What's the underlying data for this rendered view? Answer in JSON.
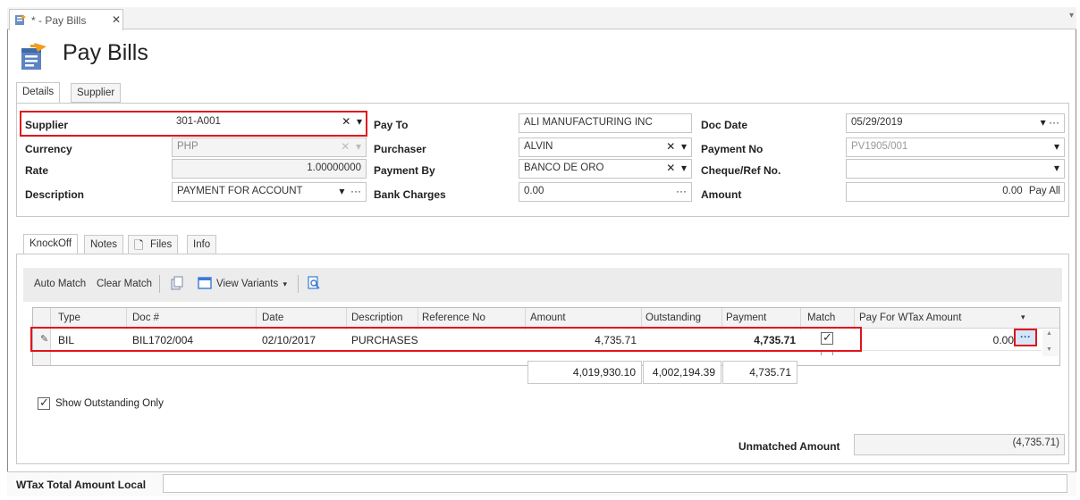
{
  "doc_tab": {
    "label": "* - Pay Bills",
    "close": "✕"
  },
  "window": {
    "menu_arrow": "▾"
  },
  "title": "Pay Bills",
  "tabs_top": [
    "Details",
    "Supplier"
  ],
  "details": {
    "supplier": {
      "label": "Supplier",
      "value": "301-A001"
    },
    "currency": {
      "label": "Currency",
      "value": "PHP"
    },
    "rate": {
      "label": "Rate",
      "value": "1.00000000"
    },
    "description": {
      "label": "Description",
      "value": "PAYMENT FOR ACCOUNT"
    },
    "pay_to": {
      "label": "Pay To",
      "value": "ALI MANUFACTURING INC"
    },
    "purchaser": {
      "label": "Purchaser",
      "value": "ALVIN"
    },
    "payment_by": {
      "label": "Payment By",
      "value": "BANCO DE ORO"
    },
    "bank_charges": {
      "label": "Bank Charges",
      "value": "0.00"
    },
    "doc_date": {
      "label": "Doc Date",
      "value": "05/29/2019"
    },
    "payment_no": {
      "label": "Payment No",
      "value": "PV1905/001"
    },
    "cheque": {
      "label": "Cheque/Ref No.",
      "value": ""
    },
    "amount": {
      "label": "Amount",
      "value": "0.00",
      "pay_all": "Pay All"
    }
  },
  "tabs_bottom": [
    "KnockOff",
    "Notes",
    "Files",
    "Info"
  ],
  "toolbar": {
    "auto_match": "Auto Match",
    "clear_match": "Clear Match",
    "view_variants": "View Variants"
  },
  "grid": {
    "columns": [
      "Type",
      "Doc #",
      "Date",
      "Description",
      "Reference No",
      "Amount",
      "Outstanding",
      "Payment",
      "Match",
      "Pay For WTax Amount"
    ],
    "rows": [
      {
        "type": "BIL",
        "doc": "BIL1702/004",
        "date": "02/10/2017",
        "description": "PURCHASES",
        "reference": "",
        "amount": "4,735.71",
        "outstanding": "",
        "payment": "4,735.71",
        "match": true,
        "wtax": "0.00"
      }
    ],
    "totals": {
      "amount": "4,019,930.10",
      "outstanding": "4,002,194.39",
      "payment": "4,735.71"
    }
  },
  "show_outstanding": {
    "label": "Show Outstanding Only",
    "checked": true
  },
  "unmatched": {
    "label": "Unmatched Amount",
    "value": "(4,735.71)"
  },
  "wtax_total": {
    "label": "WTax Total Amount Local",
    "value": ""
  }
}
